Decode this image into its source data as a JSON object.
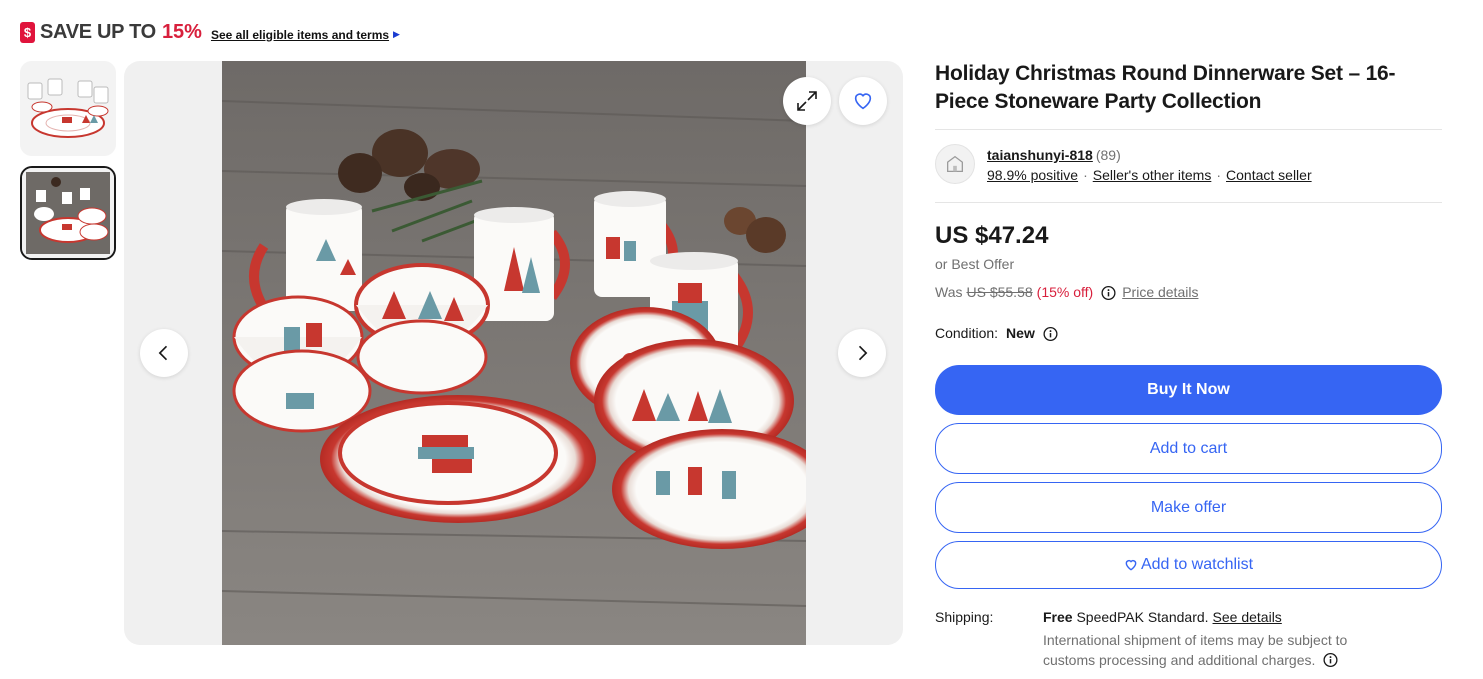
{
  "promo": {
    "text": "SAVE UP TO",
    "percent": "15%",
    "link": "See all eligible items and terms",
    "tag_symbol": "$"
  },
  "listing": {
    "title": "Holiday Christmas Round Dinnerware Set – 16-Piece Stoneware Party Collection"
  },
  "seller": {
    "name": "taianshunyi-818",
    "feedback_count": "(89)",
    "positive": "98.9% positive",
    "other_items": "Seller's other items",
    "contact": "Contact seller"
  },
  "pricing": {
    "price": "US $47.24",
    "best_offer": "or Best Offer",
    "was_label": "Was",
    "was_price": "US $55.58",
    "discount": "(15% off)",
    "price_details": "Price details"
  },
  "condition": {
    "label": "Condition:",
    "value": "New"
  },
  "actions": {
    "buy_now": "Buy It Now",
    "add_to_cart": "Add to cart",
    "make_offer": "Make offer",
    "watchlist": "Add to watchlist"
  },
  "shipping": {
    "label": "Shipping:",
    "free": "Free",
    "service": "SpeedPAK Standard.",
    "see_details": "See details",
    "note": "International shipment of items may be subject to customs processing and additional charges."
  },
  "gallery": {
    "thumbnail_count": 2,
    "selected_thumbnail": 2
  },
  "colors": {
    "accent": "#3665f3",
    "sale": "#d81f3c",
    "text": "#191919",
    "muted": "#707070"
  }
}
